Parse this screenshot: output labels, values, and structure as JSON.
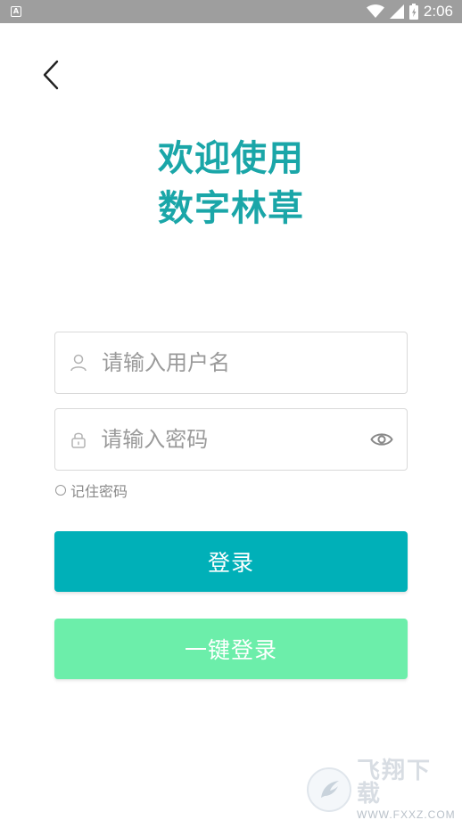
{
  "status_bar": {
    "notification_icon": "A",
    "time": "2:06",
    "icons": [
      "wifi-icon",
      "signal-icon",
      "battery-icon"
    ]
  },
  "welcome": {
    "line1": "欢迎使用",
    "line2": "数字林草"
  },
  "username": {
    "placeholder": "请输入用户名",
    "value": ""
  },
  "password": {
    "placeholder": "请输入密码",
    "value": ""
  },
  "remember": {
    "label": "记住密码",
    "checked": false
  },
  "buttons": {
    "login_label": "登录",
    "onekey_label": "一键登录"
  },
  "watermark": {
    "title": "飞翔下载",
    "url": "WWW.FXXZ.COM"
  },
  "colors": {
    "accent": "#1aa6a8",
    "login_button": "#00b0b8",
    "onekey_button": "#6ceeaa",
    "status_bar": "#9e9e9e"
  }
}
